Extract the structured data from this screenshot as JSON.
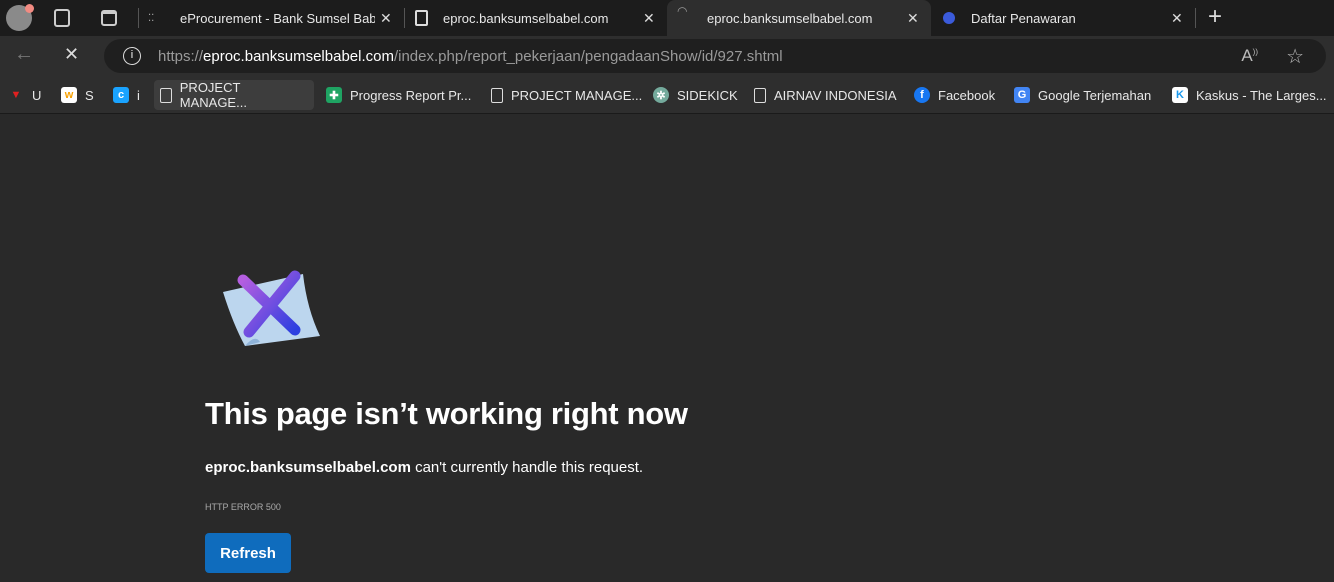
{
  "tabs": [
    {
      "title": "eProcurement - Bank Sumsel Bab"
    },
    {
      "title": "eproc.banksumselbabel.com"
    },
    {
      "title": "eproc.banksumselbabel.com"
    },
    {
      "title": "Daftar Penawaran"
    }
  ],
  "address": {
    "scheme": "https://",
    "host": "eproc.banksumselbabel.com",
    "path": "/index.php/report_pekerjaan/pengadaanShow/id/927.shtml"
  },
  "bookmarks": [
    {
      "label": "U"
    },
    {
      "label": "S"
    },
    {
      "label": "i"
    },
    {
      "label": "PROJECT MANAGE..."
    },
    {
      "label": "Progress Report Pr..."
    },
    {
      "label": "PROJECT MANAGE..."
    },
    {
      "label": "SIDEKICK"
    },
    {
      "label": "AIRNAV INDONESIA"
    },
    {
      "label": "Facebook"
    },
    {
      "label": "Google Terjemahan"
    },
    {
      "label": "Kaskus - The Larges..."
    }
  ],
  "error": {
    "title": "This page isn’t working right now",
    "host": "eproc.banksumselbabel.com",
    "message": " can't currently handle this request.",
    "code": "HTTP ERROR 500",
    "refresh": "Refresh"
  }
}
